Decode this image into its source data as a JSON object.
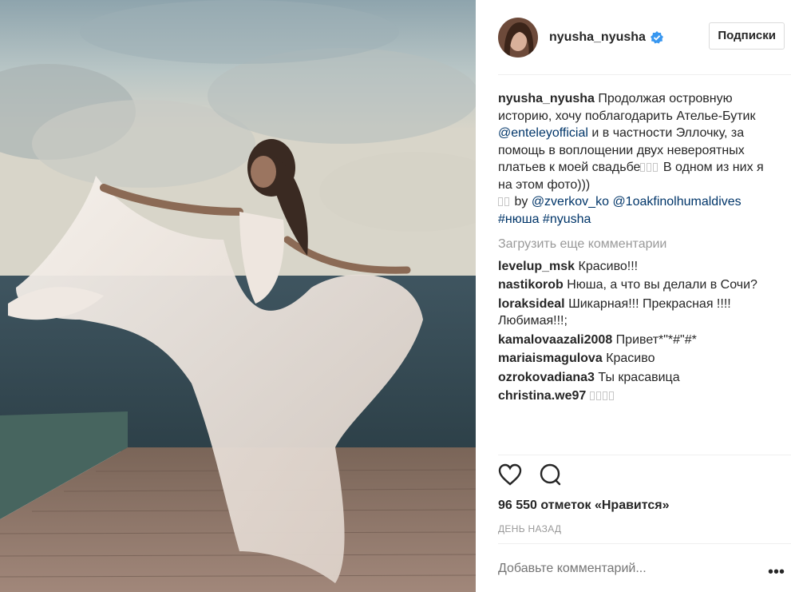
{
  "post": {
    "username": "nyusha_nyusha",
    "follow_label": "Подписки",
    "caption": {
      "author": "nyusha_nyusha",
      "text_1": "Продолжая островную историю, хочу поблагодарить Ателье-Бутик",
      "mention_1": "@enteleyofficial",
      "text_2": "и в частности Эллочку, за помощь в воплощении двух невероятных платьев к моей свадьбе",
      "text_3": "В одном из них я на этом фото)))",
      "by_label": "by",
      "mention_2": "@zverkov_ko",
      "mention_3": "@1oakfinolhumaldives",
      "hashtag_1": "#нюша",
      "hashtag_2": "#nyusha"
    },
    "load_more_label": "Загрузить еще комментарии",
    "comments": [
      {
        "user": "levelup_msk",
        "text": "Красиво!!!"
      },
      {
        "user": "nastikorob",
        "text": "Нюша, а что вы делали в Сочи?"
      },
      {
        "user": "loraksideal",
        "text": "Шикарная!!! Прекрасная !!!! Любимая!!!;"
      },
      {
        "user": "kamalovaazali2008",
        "text": "Привет*\"*#\"#*"
      },
      {
        "user": "mariaismagulova",
        "text": "Красиво"
      },
      {
        "user": "ozrokovadiana3",
        "text": "Ты красавица"
      },
      {
        "user": "christina.we97",
        "text": ""
      }
    ],
    "likes_text": "96 550 отметок «Нравится»",
    "time_text": "ДЕНЬ НАЗАД",
    "add_comment_placeholder": "Добавьте комментарий...",
    "more_label": "•••"
  },
  "icons": {
    "like": "heart-icon",
    "comment": "comment-bubble-icon",
    "verified": "verified-badge-icon",
    "more": "more-options-icon"
  },
  "colors": {
    "link": "#003569",
    "verified": "#3897f0",
    "muted": "#999999"
  }
}
